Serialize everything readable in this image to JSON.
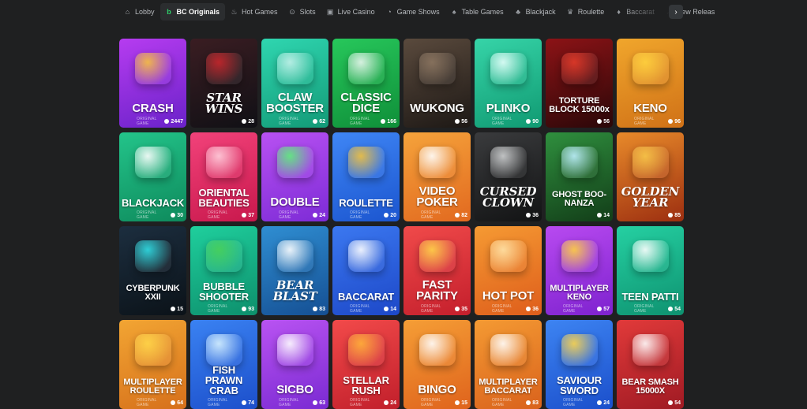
{
  "nav": {
    "tabs": [
      {
        "label": "Lobby",
        "icon": "home-icon",
        "glyph": "⌂",
        "active": false
      },
      {
        "label": "BC Originals",
        "icon": "bc-logo-icon",
        "glyph": "b",
        "active": true
      },
      {
        "label": "Hot Games",
        "icon": "flame-icon",
        "glyph": "♨",
        "active": false
      },
      {
        "label": "Slots",
        "icon": "slot-icon",
        "glyph": "⊙",
        "active": false
      },
      {
        "label": "Live Casino",
        "icon": "live-icon",
        "glyph": "▣",
        "active": false
      },
      {
        "label": "Game Shows",
        "icon": "wheel-icon",
        "glyph": "◔",
        "active": false
      },
      {
        "label": "Table Games",
        "icon": "cards-icon",
        "glyph": "♠",
        "active": false
      },
      {
        "label": "Blackjack",
        "icon": "blackjack-icon",
        "glyph": "♣",
        "active": false
      },
      {
        "label": "Roulette",
        "icon": "roulette-icon",
        "glyph": "♛",
        "active": false
      },
      {
        "label": "Baccarat",
        "icon": "baccarat-icon",
        "glyph": "♦",
        "active": false
      },
      {
        "label": "New Releas",
        "icon": "rocket-icon",
        "glyph": "➚",
        "active": false
      }
    ],
    "next_glyph": "›"
  },
  "games": [
    {
      "title": "CRASH",
      "players": "2447",
      "sub": "ORIGINAL GAME",
      "bg1": "#b63cf0",
      "bg2": "#6a22c9",
      "deco": "#f7c33d"
    },
    {
      "title": "STAR WINS",
      "players": "28",
      "sub": "",
      "bg1": "#3a1d22",
      "bg2": "#101015",
      "deco": "#c8282d",
      "style": "logo"
    },
    {
      "title": "CLAW BOOSTER",
      "players": "62",
      "sub": "ORIGINAL GAME",
      "bg1": "#2fd6b0",
      "bg2": "#139a77",
      "deco": "#c4f1ea"
    },
    {
      "title": "CLASSIC DICE",
      "players": "166",
      "sub": "ORIGINAL GAME",
      "bg1": "#27c75b",
      "bg2": "#0f8f39",
      "deco": "#eaf6ef"
    },
    {
      "title": "WUKONG",
      "players": "56",
      "sub": "",
      "bg1": "#5a4a3d",
      "bg2": "#1d1815",
      "deco": "#8c7661"
    },
    {
      "title": "PLINKO",
      "players": "90",
      "sub": "ORIGINAL GAME",
      "bg1": "#36d4a8",
      "bg2": "#109a72",
      "deco": "#e6fffb"
    },
    {
      "title": "TORTURE BLOCK 15000x",
      "players": "56",
      "sub": "",
      "bg1": "#8c1316",
      "bg2": "#2a0708",
      "deco": "#e23b2a",
      "style": "small"
    },
    {
      "title": "KENO",
      "players": "96",
      "sub": "ORIGINAL GAME",
      "bg1": "#f0a62c",
      "bg2": "#d07117",
      "deco": "#ffd23f"
    },
    {
      "title": "BLACKJACK",
      "players": "30",
      "sub": "ORIGINAL GAME",
      "bg1": "#23c48a",
      "bg2": "#0e8a5c",
      "deco": "#ffffff",
      "style": "med"
    },
    {
      "title": "ORIENTAL BEAUTIES",
      "players": "37",
      "sub": "ORIGINAL GAME",
      "bg1": "#f2427a",
      "bg2": "#c8184c",
      "deco": "#ffd0dd",
      "style": "med"
    },
    {
      "title": "DOUBLE",
      "players": "24",
      "sub": "ORIGINAL GAME",
      "bg1": "#b851f2",
      "bg2": "#7d2bd6",
      "deco": "#5ef27a"
    },
    {
      "title": "ROULETTE",
      "players": "20",
      "sub": "ORIGINAL GAME",
      "bg1": "#3f86f5",
      "bg2": "#1b55cf",
      "deco": "#f4c23c",
      "style": "med"
    },
    {
      "title": "VIDEO POKER",
      "players": "82",
      "sub": "ORIGINAL GAME",
      "bg1": "#f5a33b",
      "bg2": "#e2691f",
      "deco": "#ffffff"
    },
    {
      "title": "CURSED CLOWN",
      "players": "36",
      "sub": "",
      "bg1": "#3a3b3d",
      "bg2": "#121314",
      "deco": "#cfd1d2",
      "style": "logo"
    },
    {
      "title": "GHOST BOO-NANZA",
      "players": "14",
      "sub": "",
      "bg1": "#2f8f3e",
      "bg2": "#123d18",
      "deco": "#bff0ff",
      "style": "small"
    },
    {
      "title": "GOLDEN YEAR",
      "players": "85",
      "sub": "",
      "bg1": "#e88a2a",
      "bg2": "#9c2e10",
      "deco": "#f7c64a",
      "style": "logo"
    },
    {
      "title": "CYBERPUNK XXII",
      "players": "15",
      "sub": "",
      "bg1": "#1c2e3f",
      "bg2": "#0b1218",
      "deco": "#31e0e7",
      "style": "small"
    },
    {
      "title": "BUBBLE SHOOTER",
      "players": "93",
      "sub": "ORIGINAL GAME",
      "bg1": "#1fcf9d",
      "bg2": "#0d8f6c",
      "deco": "#4ad05a",
      "style": "med"
    },
    {
      "title": "BEAR BLAST",
      "players": "83",
      "sub": "",
      "bg1": "#2f8ed2",
      "bg2": "#154f93",
      "deco": "#ffffff",
      "style": "logo"
    },
    {
      "title": "BACCARAT",
      "players": "14",
      "sub": "ORIGINAL GAME",
      "bg1": "#3b78f0",
      "bg2": "#1d48c8",
      "deco": "#ffffff",
      "style": "med"
    },
    {
      "title": "FAST PARITY",
      "players": "35",
      "sub": "ORIGINAL GAME",
      "bg1": "#f04a4a",
      "bg2": "#c41f2c",
      "deco": "#ffd54a"
    },
    {
      "title": "HOT POT",
      "players": "36",
      "sub": "ORIGINAL GAME",
      "bg1": "#f59a33",
      "bg2": "#de5d1b",
      "deco": "#ffe3a8"
    },
    {
      "title": "MULTIPLAYER KENO",
      "players": "57",
      "sub": "ORIGINAL GAME",
      "bg1": "#b84af0",
      "bg2": "#7e22cf",
      "deco": "#ffd23f",
      "style": "small"
    },
    {
      "title": "TEEN PATTI",
      "players": "54",
      "sub": "ORIGINAL GAME",
      "bg1": "#25d0a2",
      "bg2": "#0e9270",
      "deco": "#ffffff",
      "style": "med"
    },
    {
      "title": "MULTIPLAYER ROULETTE",
      "players": "64",
      "sub": "ORIGINAL GAME",
      "bg1": "#f2a533",
      "bg2": "#d6701b",
      "deco": "#ffd64a",
      "style": "small"
    },
    {
      "title": "FISH PRAWN CRAB",
      "players": "74",
      "sub": "ORIGINAL GAME",
      "bg1": "#3a82f2",
      "bg2": "#1c4fcb",
      "deco": "#d8f2ff",
      "style": "med"
    },
    {
      "title": "SICBO",
      "players": "63",
      "sub": "ORIGINAL GAME",
      "bg1": "#b953f2",
      "bg2": "#7a2ad2",
      "deco": "#ffffff"
    },
    {
      "title": "STELLAR RUSH",
      "players": "24",
      "sub": "ORIGINAL GAME",
      "bg1": "#f24a4a",
      "bg2": "#c11f2b",
      "deco": "#ffb33a",
      "style": "med"
    },
    {
      "title": "BINGO",
      "players": "15",
      "sub": "ORIGINAL GAME",
      "bg1": "#f59e36",
      "bg2": "#df631c",
      "deco": "#ffffff"
    },
    {
      "title": "MULTIPLAYER BACCARAT",
      "players": "83",
      "sub": "ORIGINAL GAME",
      "bg1": "#f49a33",
      "bg2": "#d9621c",
      "deco": "#ffffff",
      "style": "small"
    },
    {
      "title": "SAVIOUR SWORD",
      "players": "24",
      "sub": "ORIGINAL GAME",
      "bg1": "#3d84f2",
      "bg2": "#1b4fcb",
      "deco": "#ffd54a",
      "style": "med"
    },
    {
      "title": "BEAR SMASH 15000X",
      "players": "54",
      "sub": "",
      "bg1": "#e13a3a",
      "bg2": "#9f1a23",
      "deco": "#ffffff",
      "style": "small"
    }
  ]
}
